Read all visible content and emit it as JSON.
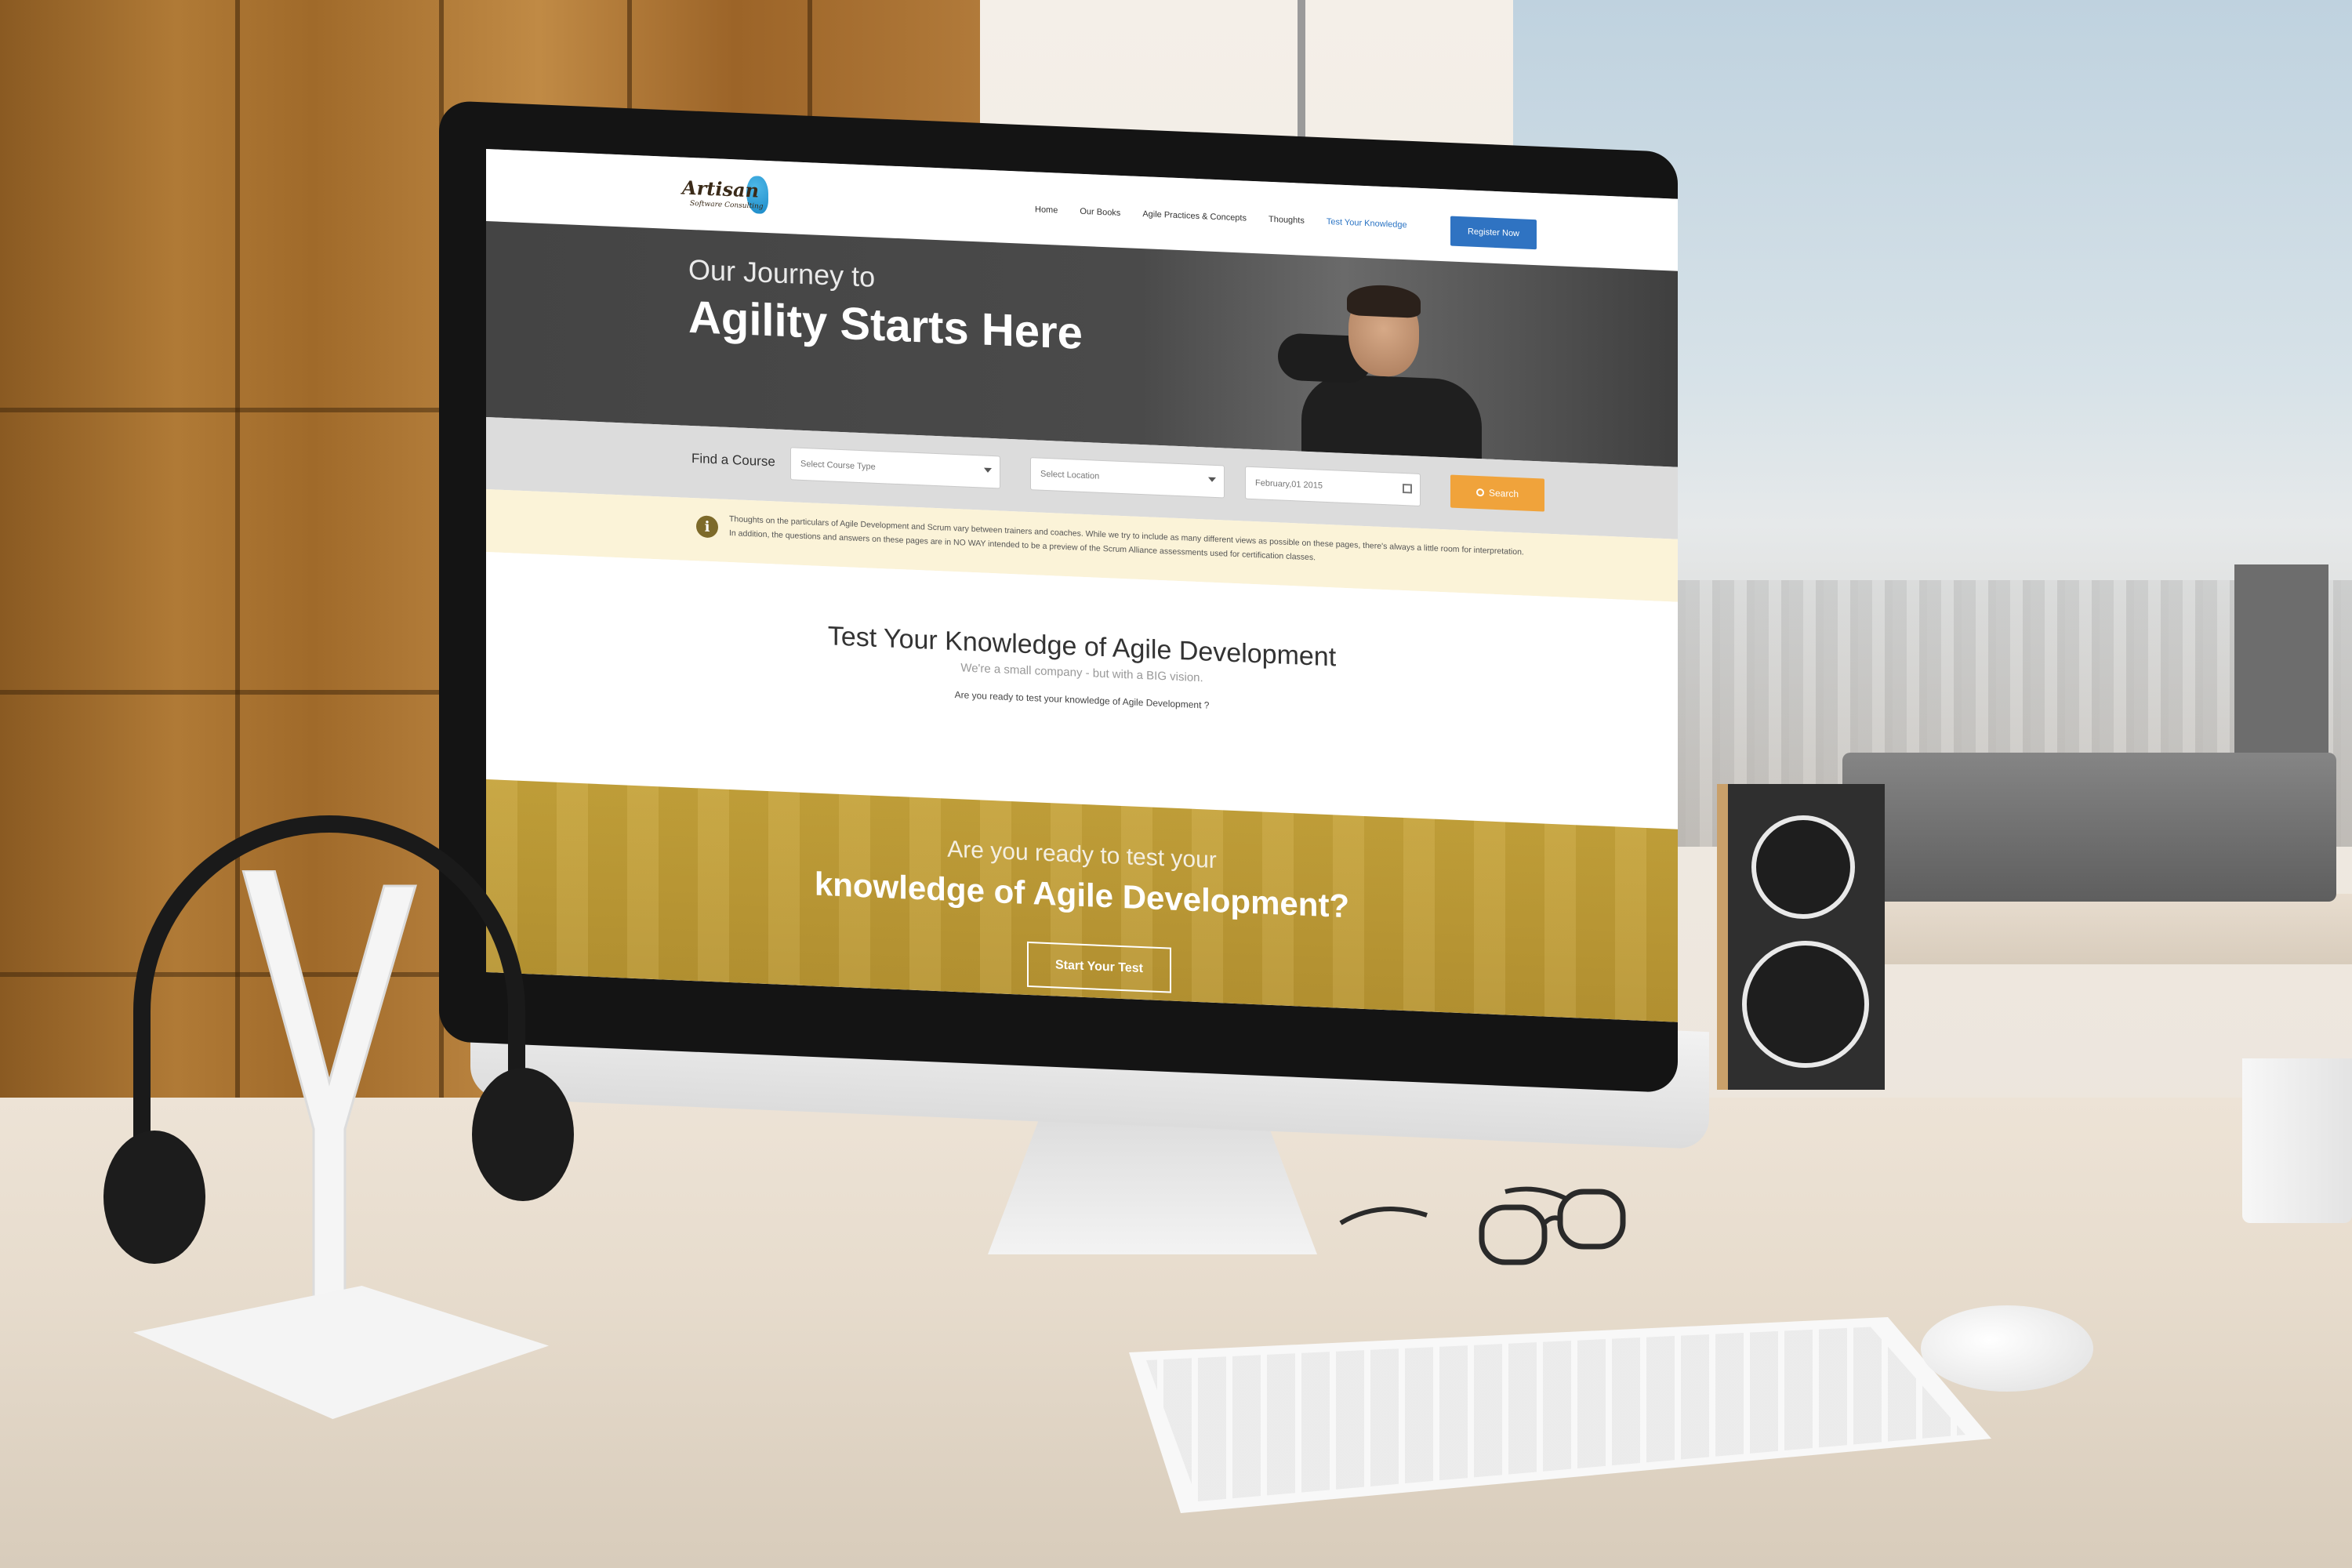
{
  "logo": {
    "name": "Artisan",
    "tagline": "Software Consulting"
  },
  "nav": {
    "items": [
      "Home",
      "Our Books",
      "Agile Practices & Concepts",
      "Thoughts",
      "Test Your Knowledge"
    ],
    "active": "Test Your Knowledge",
    "register_label": "Register Now"
  },
  "hero": {
    "line1": "Our Journey to",
    "line2": "Agility Starts Here"
  },
  "search": {
    "label": "Find a Course",
    "course_type_placeholder": "Select Course Type",
    "location_placeholder": "Select Location",
    "date_value": "February,01 2015",
    "button_label": "Search"
  },
  "notice": {
    "text": "Thoughts on the particulars of Agile Development and Scrum vary between trainers and coaches. While we try to include as many different views as possible on these pages, there's always a little room for interpretation. In addition, the questions and answers on these pages are in NO WAY intended to be a preview of the Scrum Alliance assessments used for certification classes."
  },
  "main": {
    "title": "Test Your Knowledge of Agile Development",
    "subtitle": "We're a small company - but with a BIG vision.",
    "question": "Are you ready to test your knowledge of Agile Development ?"
  },
  "banner": {
    "line1": "Are you ready to test your",
    "line2": "knowledge of Agile Development?",
    "button_label": "Start Your Test"
  },
  "colors": {
    "nav_active": "#2b74c4",
    "register_button": "#2f73c2",
    "search_button": "#f0a33b",
    "hero_bg": "#444444",
    "banner_bg": "#c6a33a",
    "notice_bg": "#fbf3d8"
  },
  "icons": [
    "info-icon",
    "search-icon",
    "calendar-icon",
    "chevron-down-icon"
  ]
}
